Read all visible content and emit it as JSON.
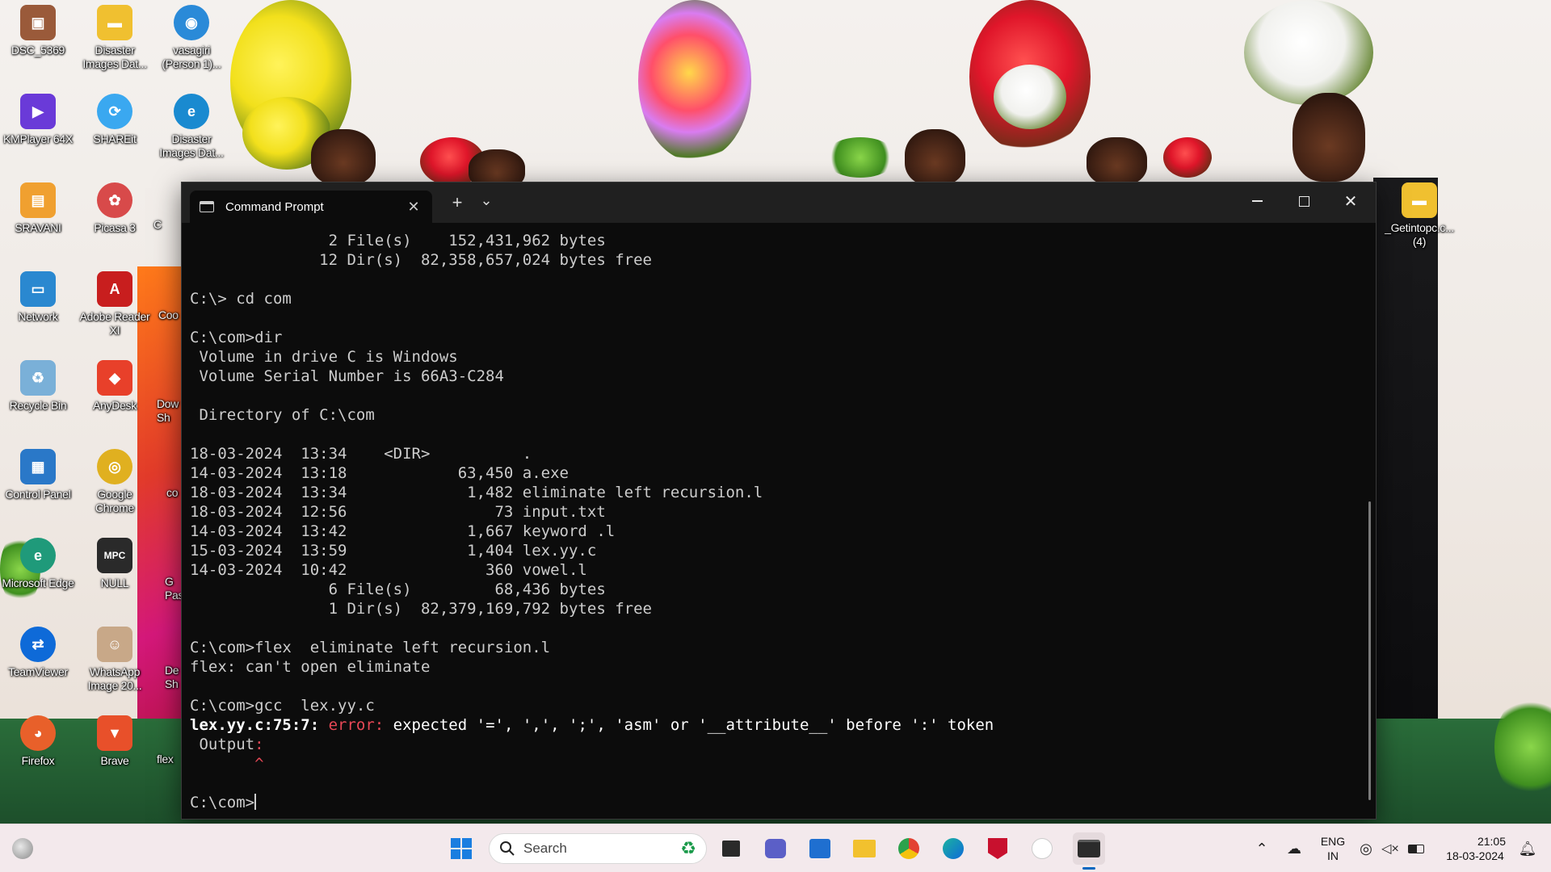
{
  "desktop": {
    "icons": [
      {
        "label": "DSC_5369",
        "glyph": "▣",
        "color": "#9a5a3a"
      },
      {
        "label": "Disaster Images Dat...",
        "glyph": "▬",
        "color": "#f0c030"
      },
      {
        "label": "vasagiri (Person 1)...",
        "glyph": "◉",
        "color": "#2a8ad8"
      },
      {
        "label": "KMPlayer 64X",
        "glyph": "▶",
        "color": "#6a3ad8"
      },
      {
        "label": "SHAREit",
        "glyph": "⟳",
        "color": "#3aa8f0"
      },
      {
        "label": "Disaster Images Dat...",
        "glyph": "e",
        "color": "#1a8ad0"
      },
      {
        "label": "SRAVANI",
        "glyph": "▤",
        "color": "#f0a030"
      },
      {
        "label": "Picasa 3",
        "glyph": "✿",
        "color": "#d84a4a"
      },
      {
        "label": "Network",
        "glyph": "▭",
        "color": "#2a88d0"
      },
      {
        "label": "Adobe Reader XI",
        "glyph": "A",
        "color": "#c81e1e"
      },
      {
        "label": "Recycle Bin",
        "glyph": "♻",
        "color": "#7ab0d8"
      },
      {
        "label": "AnyDesk",
        "glyph": "◆",
        "color": "#e8402a"
      },
      {
        "label": "Control Panel",
        "glyph": "▦",
        "color": "#2a78c8"
      },
      {
        "label": "Google Chrome",
        "glyph": "◎",
        "color": "#e0b020"
      },
      {
        "label": "Microsoft Edge",
        "glyph": "e",
        "color": "#1f9a7a"
      },
      {
        "label": "NULL",
        "glyph": "MPC",
        "color": "#2a2a2a"
      },
      {
        "label": "TeamViewer",
        "glyph": "⇄",
        "color": "#0e6ad8"
      },
      {
        "label": "WhatsApp Image 20...",
        "glyph": "☺",
        "color": "#c8a888"
      },
      {
        "label": "Firefox",
        "glyph": "◕",
        "color": "#e8602a"
      },
      {
        "label": "Brave",
        "glyph": "▼",
        "color": "#e8502a"
      },
      {
        "label": "_Getintopc.c... (4)",
        "glyph": "▬",
        "color": "#f0c030"
      }
    ],
    "partial_labels": [
      "C",
      "Coo",
      "Dow Sh",
      "co",
      "G Pas",
      "De Sh",
      "flex"
    ]
  },
  "window": {
    "tab_title": "Command Prompt",
    "new_tab": "+",
    "dropdown": "⌄",
    "close_tab": "✕",
    "close_window": "✕"
  },
  "console": {
    "lines": [
      "               2 File(s)    152,431,962 bytes",
      "              12 Dir(s)  82,358,657,024 bytes free",
      "",
      "C:\\> cd com",
      "",
      "C:\\com>dir",
      " Volume in drive C is Windows",
      " Volume Serial Number is 66A3-C284",
      "",
      " Directory of C:\\com",
      "",
      "18-03-2024  13:34    <DIR>          .",
      "14-03-2024  13:18            63,450 a.exe",
      "18-03-2024  13:34             1,482 eliminate left recursion.l",
      "18-03-2024  12:56                73 input.txt",
      "14-03-2024  13:42             1,667 keyword .l",
      "15-03-2024  13:59             1,404 lex.yy.c",
      "14-03-2024  10:42               360 vowel.l",
      "               6 File(s)         68,436 bytes",
      "               1 Dir(s)  82,379,169,792 bytes free",
      "",
      "C:\\com>flex  eliminate left recursion.l",
      "flex: can't open eliminate",
      "",
      "C:\\com>gcc  lex.yy.c"
    ],
    "error_file": "lex.yy.c:75:7: ",
    "error_word": "error:",
    "error_msg": " expected '=', ',', ';', 'asm' or '__attribute__' before ':' token",
    "output_label": " Output",
    "output_colon": ":",
    "caret_line": "       ^",
    "prompt": "C:\\com>"
  },
  "taskbar": {
    "search_placeholder": "Search",
    "language_line1": "ENG",
    "language_line2": "IN",
    "time": "21:05",
    "date": "18-03-2024"
  },
  "colors": {
    "terminal_bg": "#0c0c0c",
    "terminal_text": "#cccccc",
    "error_red": "#e74856",
    "titlebar": "#202020",
    "taskbar": "#f3e9ec"
  }
}
